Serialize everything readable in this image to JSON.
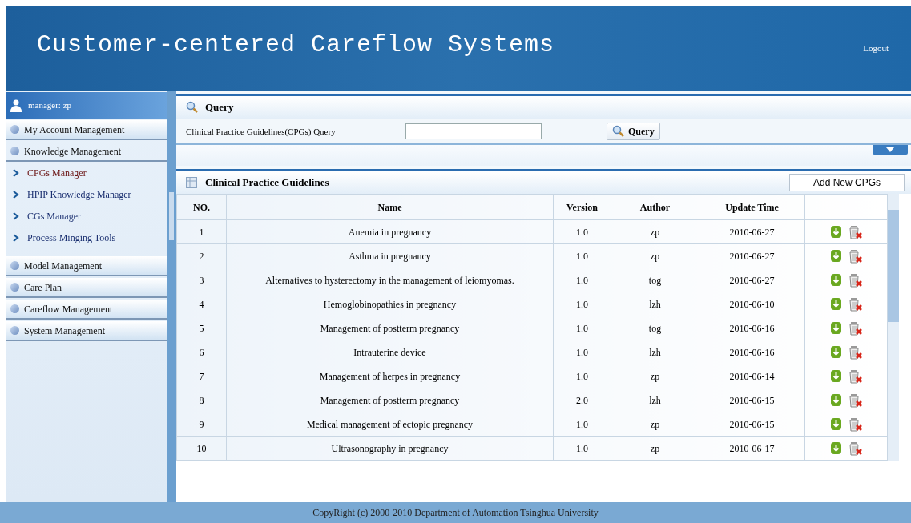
{
  "header": {
    "title": "Customer-centered Careflow Systems",
    "logout": "Logout"
  },
  "sidebar": {
    "user": "manager: zp",
    "items": [
      {
        "label": "My Account Management",
        "expanded": false
      },
      {
        "label": "Knowledge Management",
        "expanded": true,
        "children": [
          {
            "label": "CPGs Manager",
            "selected": true
          },
          {
            "label": "HPIP Knowledge Manager",
            "selected": false
          },
          {
            "label": "CGs Manager",
            "selected": false
          },
          {
            "label": "Process Minging Tools",
            "selected": false
          }
        ]
      },
      {
        "label": "Model Management",
        "expanded": false
      },
      {
        "label": "Care Plan",
        "expanded": false
      },
      {
        "label": "Careflow Management",
        "expanded": false
      },
      {
        "label": "System Management",
        "expanded": false
      }
    ]
  },
  "query": {
    "title": "Query",
    "label": "Clinical Practice Guidelines(CPGs) Query",
    "button": "Query"
  },
  "table": {
    "title": "Clinical Practice Guidelines",
    "add_button": "Add New CPGs",
    "columns": [
      "NO.",
      "Name",
      "Version",
      "Author",
      "Update Time"
    ],
    "rows": [
      [
        "1",
        "Anemia in pregnancy",
        "1.0",
        "zp",
        "2010-06-27"
      ],
      [
        "2",
        "Asthma in pregnancy",
        "1.0",
        "zp",
        "2010-06-27"
      ],
      [
        "3",
        "Alternatives to hysterectomy in the management of leiomyomas.",
        "1.0",
        "tog",
        "2010-06-27"
      ],
      [
        "4",
        "Hemoglobinopathies in pregnancy",
        "1.0",
        "lzh",
        "2010-06-10"
      ],
      [
        "5",
        "Management of postterm pregnancy",
        "1.0",
        "tog",
        "2010-06-16"
      ],
      [
        "6",
        "Intrauterine device",
        "1.0",
        "lzh",
        "2010-06-16"
      ],
      [
        "7",
        "Management of herpes in pregnancy",
        "1.0",
        "zp",
        "2010-06-14"
      ],
      [
        "8",
        "Management of postterm pregnancy",
        "2.0",
        "lzh",
        "2010-06-15"
      ],
      [
        "9",
        "Medical management of ectopic pregnancy",
        "1.0",
        "zp",
        "2010-06-15"
      ],
      [
        "10",
        "Ultrasonography in pregnancy",
        "1.0",
        "zp",
        "2010-06-17"
      ]
    ]
  },
  "footer": "CopyRight (c) 2000-2010 Department of Automation Tsinghua University"
}
